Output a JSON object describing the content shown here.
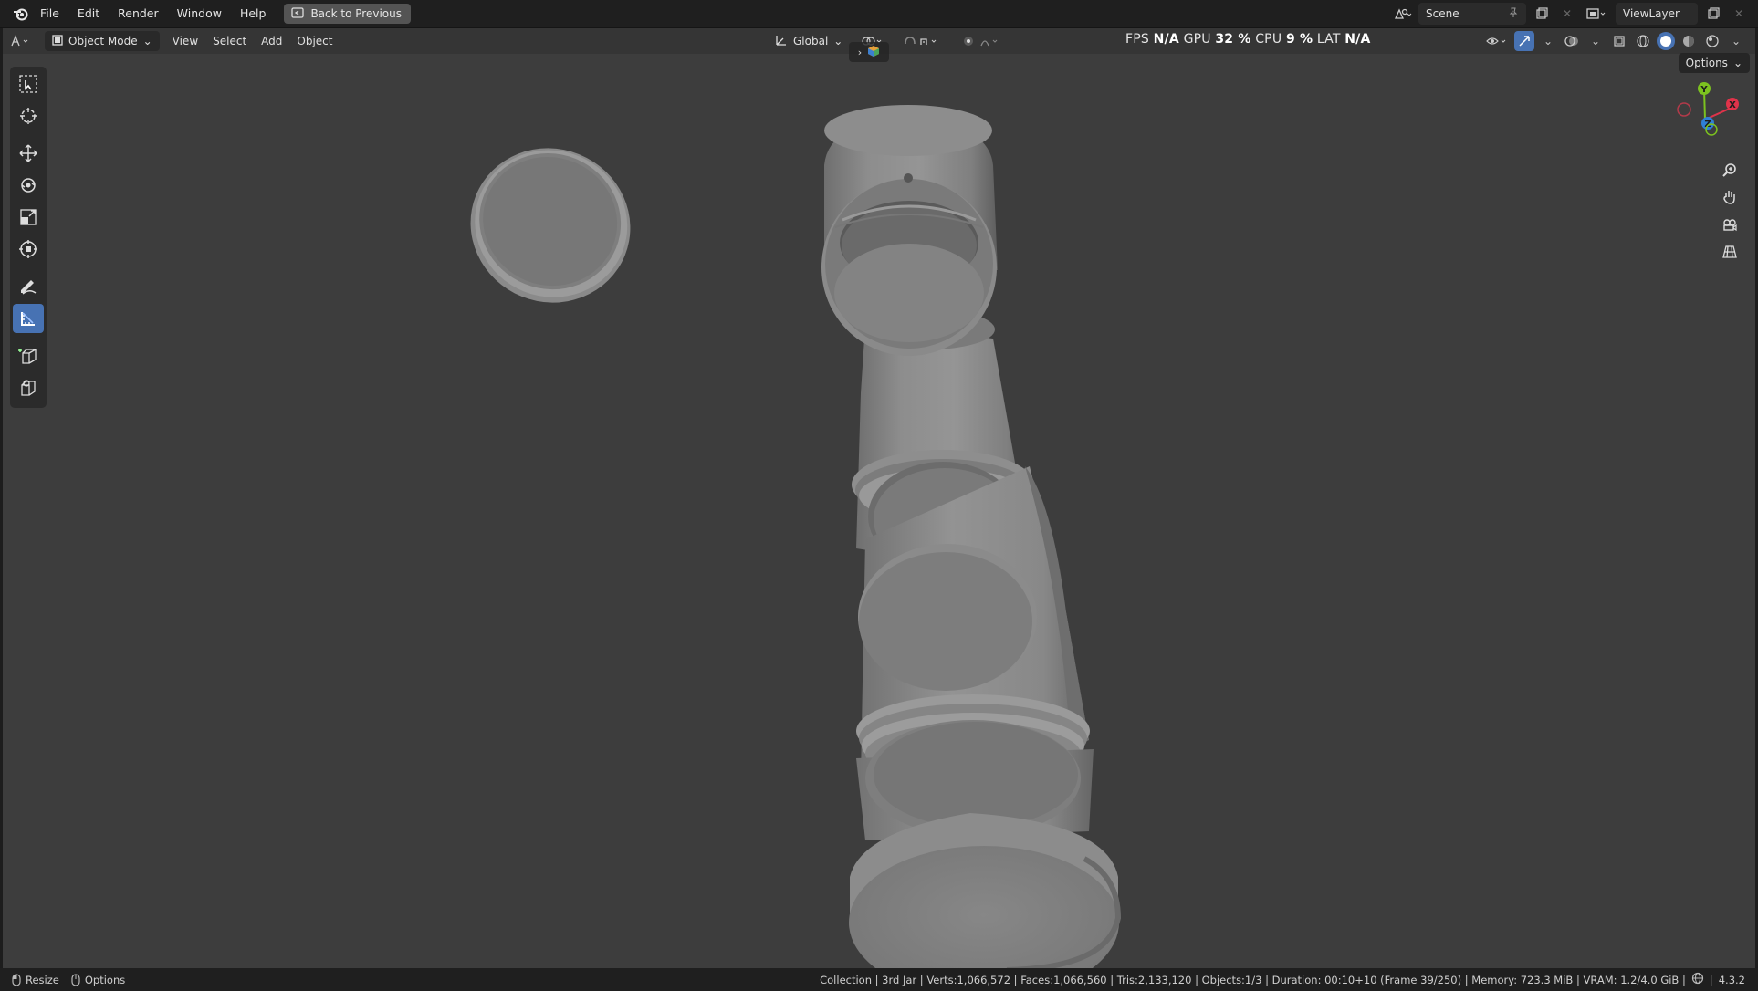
{
  "menubar": {
    "items": [
      "File",
      "Edit",
      "Render",
      "Window",
      "Help"
    ],
    "back_button": "Back to Previous",
    "scene": "Scene",
    "view_layer": "ViewLayer"
  },
  "viewport_header": {
    "mode": "Object Mode",
    "menus": [
      "View",
      "Select",
      "Add",
      "Object"
    ],
    "transform_orientation": "Global",
    "options": "Options"
  },
  "stats": {
    "fps_label": "FPS",
    "fps_value": "N/A",
    "gpu_label": "GPU",
    "gpu_value": "32 %",
    "cpu_label": "CPU",
    "cpu_value": "9 %",
    "lat_label": "LAT",
    "lat_value": "N/A"
  },
  "gizmo": {
    "x": "X",
    "y": "Y",
    "z": "Z"
  },
  "statusbar": {
    "left": [
      "Resize",
      "Options"
    ],
    "info": "Collection | 3rd Jar | Verts:1,066,572 | Faces:1,066,560 | Tris:2,133,120 | Objects:1/3 | Duration: 00:10+10 (Frame 39/250) | Memory: 723.3 MiB | VRAM: 1.2/4.0 GiB |",
    "version": "4.3.2"
  },
  "colors": {
    "viewport_bg": "#3d3d3d",
    "active_tool": "#4772b3",
    "axis_x": "#e0334a",
    "axis_y": "#7cc21f",
    "axis_z": "#2f7fd6"
  }
}
